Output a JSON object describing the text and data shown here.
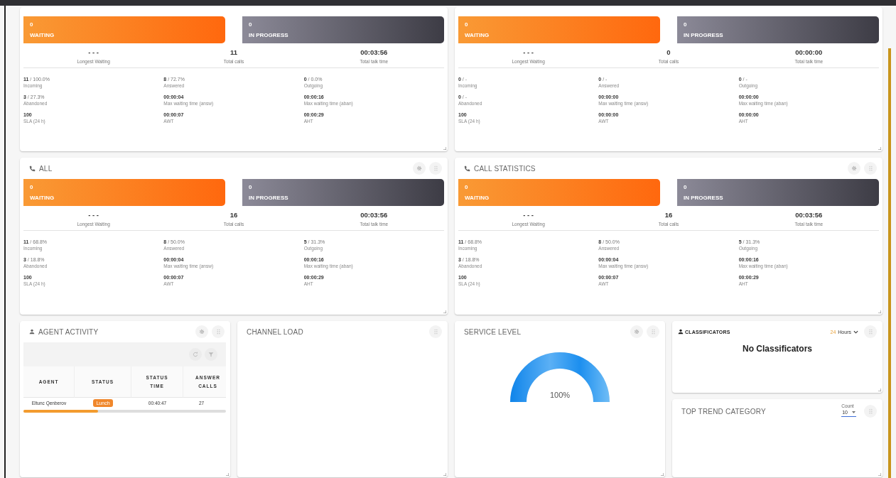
{
  "panels": [
    {
      "kind": "stats",
      "settings_button": false,
      "waiting": {
        "count": "0",
        "label": "WAITING"
      },
      "in_progress": {
        "count": "0",
        "label": "IN PROGRESS"
      },
      "summary": [
        {
          "value": "- - -",
          "label": "Longest Waiting"
        },
        {
          "value": "11",
          "label": "Total calls"
        },
        {
          "value": "00:03:56",
          "label": "Total talk time"
        }
      ],
      "metrics": [
        {
          "value": "11",
          "share": "/ 100.0%",
          "label": "Incoming"
        },
        {
          "value": "8",
          "share": "/ 72.7%",
          "label": "Answered"
        },
        {
          "value": "0",
          "share": "/ 0.0%",
          "label": "Outgoing"
        },
        {
          "value": "3",
          "share": "/ 27.3%",
          "label": "Abandoned"
        },
        {
          "value": "00:00:04",
          "label": "Max waiting time (answ)"
        },
        {
          "value": "00:00:16",
          "label": "Max waiting time (aban)"
        },
        {
          "value": "100",
          "label": "SLA (24 h)"
        },
        {
          "value": "00:00:07",
          "label": "AWT"
        },
        {
          "value": "00:00:29",
          "label": "AHT"
        }
      ]
    },
    {
      "kind": "stats",
      "settings_button": false,
      "waiting": {
        "count": "0",
        "label": "WAITING"
      },
      "in_progress": {
        "count": "0",
        "label": "IN PROGRESS"
      },
      "summary": [
        {
          "value": "- - -",
          "label": "Longest Waiting"
        },
        {
          "value": "0",
          "label": "Total calls"
        },
        {
          "value": "00:00:00",
          "label": "Total talk time"
        }
      ],
      "metrics": [
        {
          "value": "0",
          "share": "/ -",
          "label": "Incoming"
        },
        {
          "value": "0",
          "share": "/ -",
          "label": "Answered"
        },
        {
          "value": "0",
          "share": "/ -",
          "label": "Outgoing"
        },
        {
          "value": "0",
          "share": "/ -",
          "label": "Abandoned"
        },
        {
          "value": "00:00:00",
          "label": "Max waiting time (answ)"
        },
        {
          "value": "00:00:00",
          "label": "Max waiting time (aban)"
        },
        {
          "value": "100",
          "label": "SLA (24 h)"
        },
        {
          "value": "00:00:00",
          "label": "AWT"
        },
        {
          "value": "00:00:00",
          "label": "AHT"
        }
      ]
    },
    {
      "kind": "stats",
      "title": "ALL",
      "settings_button": true,
      "waiting": {
        "count": "0",
        "label": "WAITING"
      },
      "in_progress": {
        "count": "0",
        "label": "IN PROGRESS"
      },
      "summary": [
        {
          "value": "- - -",
          "label": "Longest Waiting"
        },
        {
          "value": "16",
          "label": "Total calls"
        },
        {
          "value": "00:03:56",
          "label": "Total talk time"
        }
      ],
      "metrics": [
        {
          "value": "11",
          "share": "/ 68.8%",
          "label": "Incoming"
        },
        {
          "value": "8",
          "share": "/ 50.0%",
          "label": "Answered"
        },
        {
          "value": "5",
          "share": "/ 31.3%",
          "label": "Outgoing"
        },
        {
          "value": "3",
          "share": "/ 18.8%",
          "label": "Abandoned"
        },
        {
          "value": "00:00:04",
          "label": "Max waiting time (answ)"
        },
        {
          "value": "00:00:16",
          "label": "Max waiting time (aban)"
        },
        {
          "value": "100",
          "label": "SLA (24 h)"
        },
        {
          "value": "00:00:07",
          "label": "AWT"
        },
        {
          "value": "00:00:29",
          "label": "AHT"
        }
      ]
    },
    {
      "kind": "stats",
      "title": "CALL STATISTICS",
      "settings_button": true,
      "waiting": {
        "count": "0",
        "label": "WAITING"
      },
      "in_progress": {
        "count": "0",
        "label": "IN PROGRESS"
      },
      "summary": [
        {
          "value": "- - -",
          "label": "Longest Waiting"
        },
        {
          "value": "16",
          "label": "Total calls"
        },
        {
          "value": "00:03:56",
          "label": "Total talk time"
        }
      ],
      "metrics": [
        {
          "value": "11",
          "share": "/ 68.8%",
          "label": "Incoming"
        },
        {
          "value": "8",
          "share": "/ 50.0%",
          "label": "Answered"
        },
        {
          "value": "5",
          "share": "/ 31.3%",
          "label": "Outgoing"
        },
        {
          "value": "3",
          "share": "/ 18.8%",
          "label": "Abandoned"
        },
        {
          "value": "00:00:04",
          "label": "Max waiting time (answ)"
        },
        {
          "value": "00:00:16",
          "label": "Max waiting time (aban)"
        },
        {
          "value": "100",
          "label": "SLA (24 h)"
        },
        {
          "value": "00:00:07",
          "label": "AWT"
        },
        {
          "value": "00:00:29",
          "label": "AHT"
        }
      ]
    },
    {
      "kind": "agents",
      "title": "AGENT ACTIVITY",
      "settings_button": true,
      "columns": [
        [
          "AGENT"
        ],
        [
          "STATUS"
        ],
        [
          "STATUS",
          "TIME"
        ],
        [
          "ANSWER",
          "CALLS"
        ]
      ],
      "rows": [
        {
          "agent": "Eltunc Qenberov",
          "status": "Lunch",
          "status_time": "00:40:47",
          "answer_calls": "27"
        }
      ]
    },
    {
      "kind": "blank",
      "title": "CHANNEL LOAD",
      "settings_button": false
    },
    {
      "kind": "gauge",
      "title": "SERVICE LEVEL",
      "settings_button": true,
      "level": 1,
      "reading": "100%"
    },
    {
      "kind": "classificators",
      "title": "CLASSIFICATORS",
      "settings_button": false,
      "period_value": "24",
      "period_unit": "Hours",
      "message": "No Classificators"
    },
    {
      "kind": "trend",
      "title": "TOP TREND CATEGORY",
      "settings_button": false,
      "count": {
        "label": "Count",
        "value": "10"
      }
    }
  ]
}
